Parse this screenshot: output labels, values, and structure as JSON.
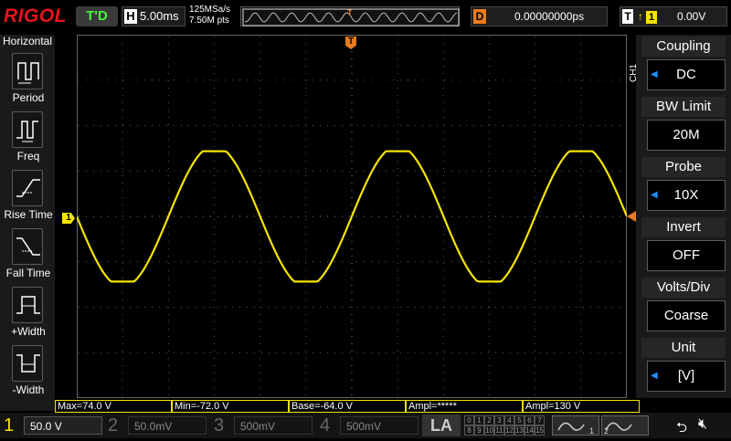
{
  "brand": "RIGOL",
  "trigger_status": "T'D",
  "timebase": {
    "key": "H",
    "value": "5.00ms"
  },
  "sample_rate": "125MSa/s",
  "memory_depth": "7.50M pts",
  "delay": {
    "key": "D",
    "value": "0.00000000ps"
  },
  "trigger": {
    "key": "T",
    "source": "1",
    "level": "0.00V"
  },
  "left_menu": {
    "title": "Horizontal",
    "items": [
      {
        "label": "Period",
        "icon": "period-icon"
      },
      {
        "label": "Freq",
        "icon": "freq-icon"
      },
      {
        "label": "Rise Time",
        "icon": "rise-time-icon"
      },
      {
        "label": "Fall Time",
        "icon": "fall-time-icon"
      },
      {
        "label": "+Width",
        "icon": "positive-width-icon"
      },
      {
        "label": "-Width",
        "icon": "negative-width-icon"
      }
    ]
  },
  "right_menu": {
    "channel_tag": "CH1",
    "items": [
      {
        "title": "Coupling",
        "value": "DC",
        "arrow": true
      },
      {
        "title": "BW Limit",
        "value": "20M",
        "arrow": false
      },
      {
        "title": "Probe",
        "value": "10X",
        "arrow": true
      },
      {
        "title": "Invert",
        "value": "OFF",
        "arrow": false
      },
      {
        "title": "Volts/Div",
        "value": "Coarse",
        "arrow": false
      },
      {
        "title": "Unit",
        "value": "[V]",
        "arrow": true
      }
    ]
  },
  "measurements": [
    "Max=74.0 V",
    "Min=-72.0 V",
    "Base=-64.0 V",
    "Ampl=*****",
    "Ampl=130 V"
  ],
  "channels": [
    {
      "num": "1",
      "scale": "50.0 V",
      "color": "#f5e400",
      "active": true
    },
    {
      "num": "2",
      "scale": "50.0mV",
      "color": "#00e5ff",
      "active": false
    },
    {
      "num": "3",
      "scale": "500mV",
      "color": "#ff3cf0",
      "active": false
    },
    {
      "num": "4",
      "scale": "500mV",
      "color": "#1e6cff",
      "active": false
    }
  ],
  "la_label": "LA",
  "la_digits": [
    "0",
    "1",
    "2",
    "3",
    "4",
    "5",
    "6",
    "7",
    "8",
    "9",
    "10",
    "11",
    "12",
    "13",
    "14",
    "15"
  ],
  "gen_labels": [
    "1",
    "2"
  ],
  "markers": {
    "ch1_ground": "1",
    "trigger_pos": "T"
  },
  "colors": {
    "ch1": "#f5e400",
    "trigger": "#e87b1e",
    "accent_blue": "#1e90ff"
  }
}
